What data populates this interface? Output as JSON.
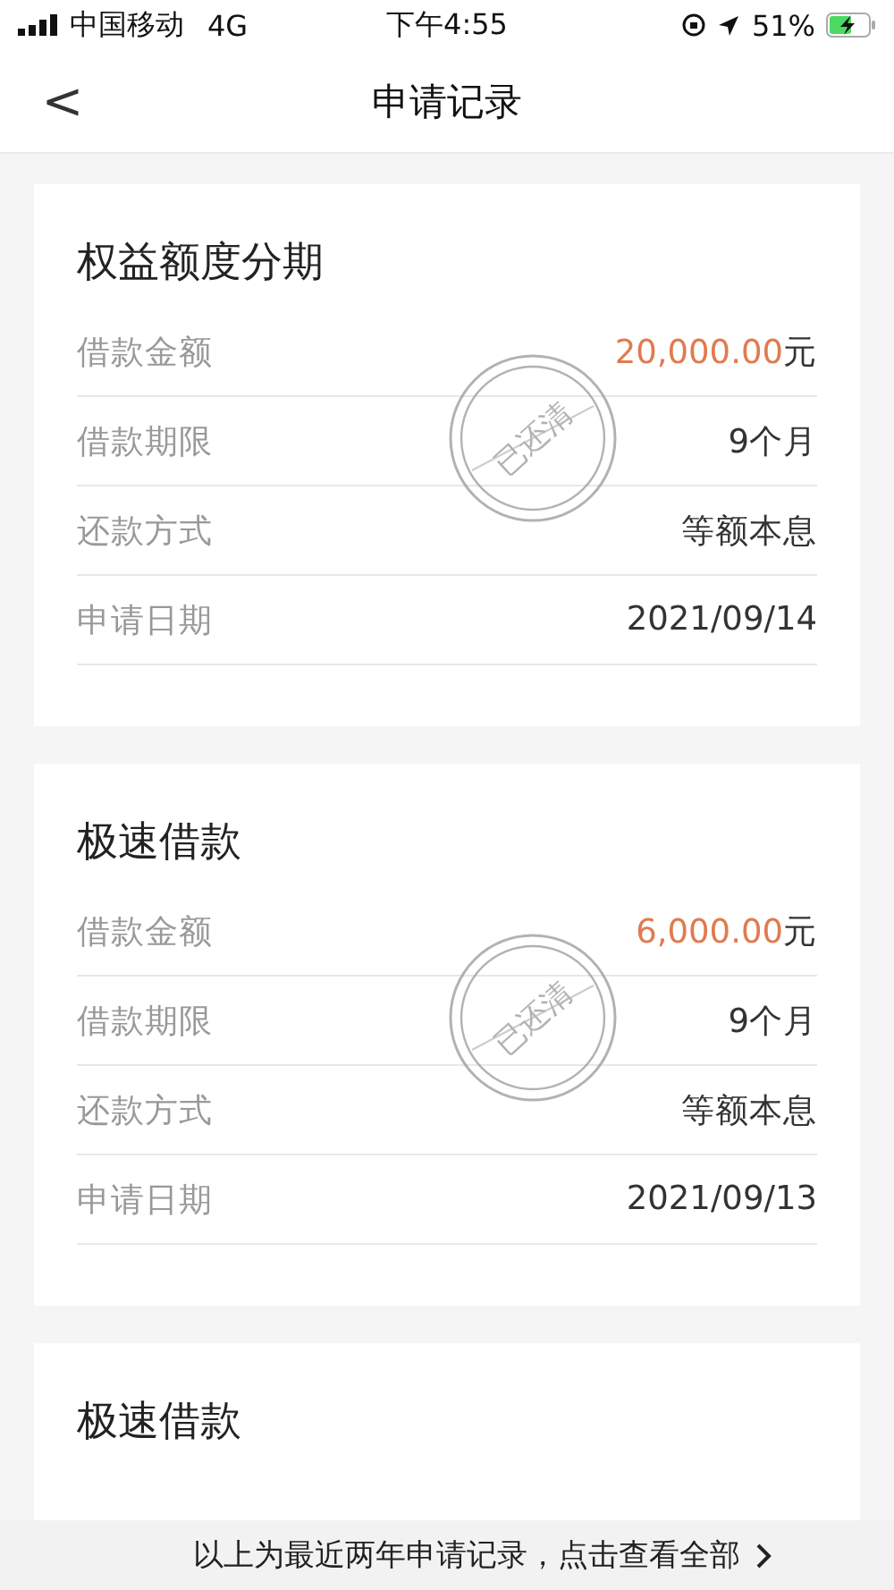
{
  "status_bar": {
    "carrier": "中国移动",
    "network": "4G",
    "time": "下午4:55",
    "battery": "51%"
  },
  "nav": {
    "back": "<",
    "title": "申请记录"
  },
  "cards": [
    {
      "title": "权益额度分期",
      "stamp": "已还清",
      "rows": [
        {
          "kind": "amount",
          "label": "借款金额",
          "value": "20,000.00",
          "unit": "元"
        },
        {
          "kind": "text",
          "label": "借款期限",
          "value": "9个月"
        },
        {
          "kind": "text",
          "label": "还款方式",
          "value": "等额本息"
        },
        {
          "kind": "text",
          "label": "申请日期",
          "value": "2021/09/14"
        }
      ]
    },
    {
      "title": "极速借款",
      "stamp": "已还清",
      "rows": [
        {
          "kind": "amount",
          "label": "借款金额",
          "value": "6,000.00",
          "unit": "元"
        },
        {
          "kind": "text",
          "label": "借款期限",
          "value": "9个月"
        },
        {
          "kind": "text",
          "label": "还款方式",
          "value": "等额本息"
        },
        {
          "kind": "text",
          "label": "申请日期",
          "value": "2021/09/13"
        }
      ]
    },
    {
      "title": "极速借款"
    }
  ],
  "footer": {
    "text": "以上为最近两年申请记录，点击查看全部"
  }
}
